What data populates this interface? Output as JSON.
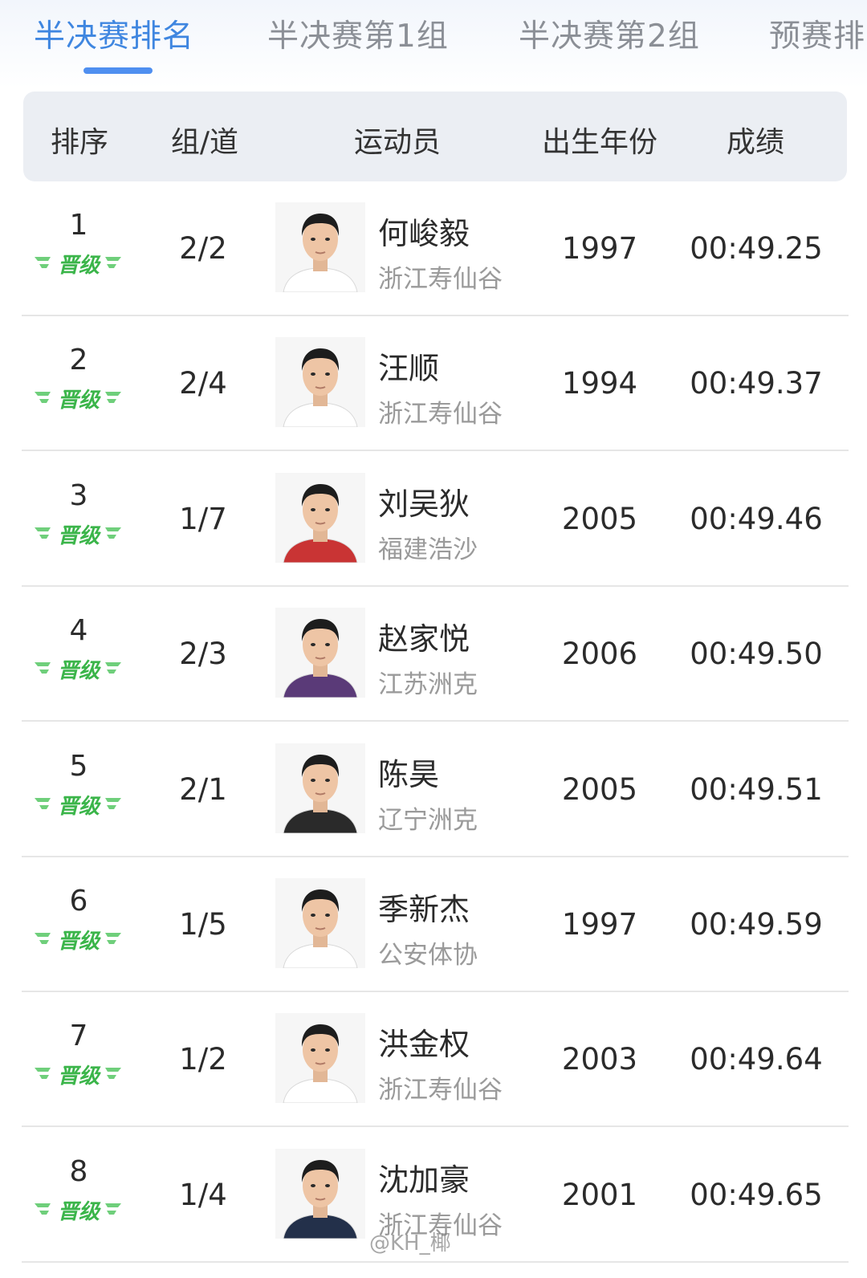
{
  "tabs": [
    {
      "label": "半决赛排名",
      "active": true
    },
    {
      "label": "半决赛第1组",
      "active": false
    },
    {
      "label": "半决赛第2组",
      "active": false
    },
    {
      "label": "预赛排",
      "active": false
    }
  ],
  "table": {
    "columns": [
      "排序",
      "组/道",
      "运动员",
      "出生年份",
      "成绩"
    ],
    "status_label": "晋级",
    "rows": [
      {
        "rank": "1",
        "lane": "2/2",
        "name": "何峻毅",
        "team": "浙江寿仙谷",
        "year": "1997",
        "time": "00:49.25",
        "shirt": "#ffffff"
      },
      {
        "rank": "2",
        "lane": "2/4",
        "name": "汪顺",
        "team": "浙江寿仙谷",
        "year": "1994",
        "time": "00:49.37",
        "shirt": "#ffffff"
      },
      {
        "rank": "3",
        "lane": "1/7",
        "name": "刘吴狄",
        "team": "福建浩沙",
        "year": "2005",
        "time": "00:49.46",
        "shirt": "#c93434"
      },
      {
        "rank": "4",
        "lane": "2/3",
        "name": "赵家悦",
        "team": "江苏洲克",
        "year": "2006",
        "time": "00:49.50",
        "shirt": "#5a3a78"
      },
      {
        "rank": "5",
        "lane": "2/1",
        "name": "陈昊",
        "team": "辽宁洲克",
        "year": "2005",
        "time": "00:49.51",
        "shirt": "#2a2a2a"
      },
      {
        "rank": "6",
        "lane": "1/5",
        "name": "季新杰",
        "team": "公安体协",
        "year": "1997",
        "time": "00:49.59",
        "shirt": "#ffffff"
      },
      {
        "rank": "7",
        "lane": "1/2",
        "name": "洪金权",
        "team": "浙江寿仙谷",
        "year": "2003",
        "time": "00:49.64",
        "shirt": "#ffffff"
      },
      {
        "rank": "8",
        "lane": "1/4",
        "name": "沈加豪",
        "team": "浙江寿仙谷",
        "year": "2001",
        "time": "00:49.65",
        "shirt": "#23304a"
      }
    ]
  },
  "watermark": {
    "credit": "@KH_椰"
  },
  "colors": {
    "accent": "#3f86e0",
    "qualified": "#3bb54a",
    "header_bg": "#ebeef3"
  }
}
